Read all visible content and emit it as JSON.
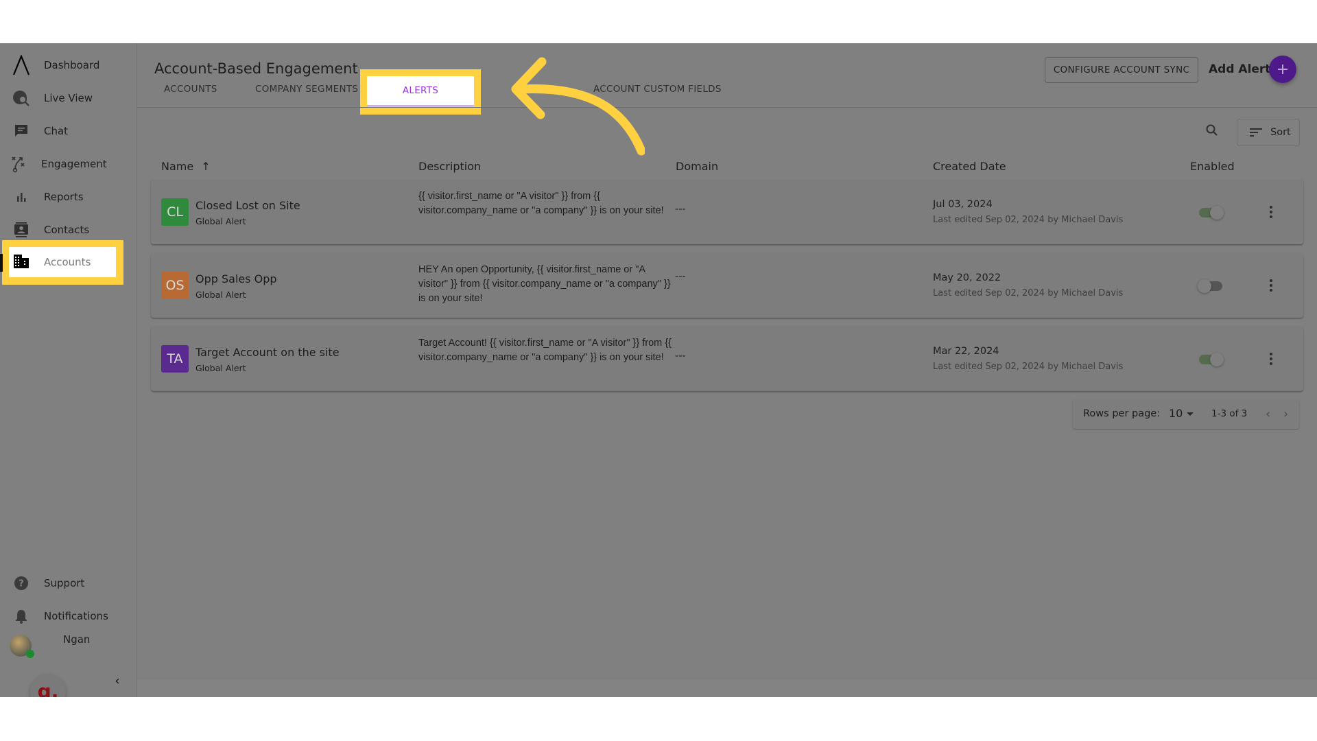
{
  "sidebar": {
    "items": [
      {
        "label": "Dashboard",
        "icon": "logo-icon"
      },
      {
        "label": "Live View",
        "icon": "live-view-icon"
      },
      {
        "label": "Chat",
        "icon": "chat-icon"
      },
      {
        "label": "Engagement",
        "icon": "engagement-icon"
      },
      {
        "label": "Reports",
        "icon": "reports-icon"
      },
      {
        "label": "Contacts",
        "icon": "contacts-icon"
      },
      {
        "label": "Accounts",
        "icon": "building-icon",
        "active": true
      }
    ],
    "bottom_items": [
      {
        "label": "Support",
        "icon": "help-icon"
      },
      {
        "label": "Notifications",
        "icon": "bell-icon"
      }
    ],
    "user": {
      "name": "Ngan"
    },
    "overlay_badge": "g.",
    "collapse_glyph": "‹"
  },
  "header": {
    "title": "Account-Based Engagement",
    "tabs": [
      {
        "label": "ACCOUNTS"
      },
      {
        "label": "COMPANY SEGMENTS"
      },
      {
        "label": "ALERTS",
        "active": true
      },
      {
        "label": "ACCOUNT CUSTOM FIELDS"
      }
    ],
    "configure_label": "CONFIGURE ACCOUNT SYNC",
    "add_alert_label": "Add Alert"
  },
  "toolbar": {
    "sort_label": "Sort"
  },
  "table": {
    "columns": [
      "Name",
      "Description",
      "Domain",
      "Created Date",
      "Enabled"
    ],
    "sort_indicator": "↑",
    "rows": [
      {
        "initials": "CL",
        "color": "#2f8a3e",
        "name": "Closed Lost on Site",
        "type": "Global Alert",
        "description": "{{ visitor.first_name or \"A visitor\" }} from {{ visitor.company_name or \"a company\" }} is on your site!",
        "domain": "---",
        "created": "Jul 03, 2024",
        "edited": "Last edited Sep 02, 2024 by Michael Davis",
        "enabled": true
      },
      {
        "initials": "OS",
        "color": "#b86a35",
        "name": "Opp Sales Opp",
        "type": "Global Alert",
        "description": "HEY An open Opportunity, {{ visitor.first_name or \"A visitor\" }} from {{ visitor.company_name or \"a company\" }} is on your site!",
        "domain": "---",
        "created": "May 20, 2022",
        "edited": "Last edited Sep 02, 2024 by Michael Davis",
        "enabled": false
      },
      {
        "initials": "TA",
        "color": "#5a2a8e",
        "name": "Target Account on the site",
        "type": "Global Alert",
        "description": "Target Account! {{ visitor.first_name or \"A visitor\" }} from {{ visitor.company_name or \"a company\" }} is on your site!",
        "domain": "---",
        "created": "Mar 22, 2024",
        "edited": "Last edited Sep 02, 2024 by Michael Davis",
        "enabled": true
      }
    ]
  },
  "pagination": {
    "rows_per_page_label": "Rows per page:",
    "rows_per_page": "10",
    "range": "1-3 of 3",
    "prev": "‹",
    "next": "›"
  },
  "colors": {
    "highlight": "#ffd040",
    "accent_purple": "#9b31e3",
    "fab": "#4e1a8a"
  }
}
